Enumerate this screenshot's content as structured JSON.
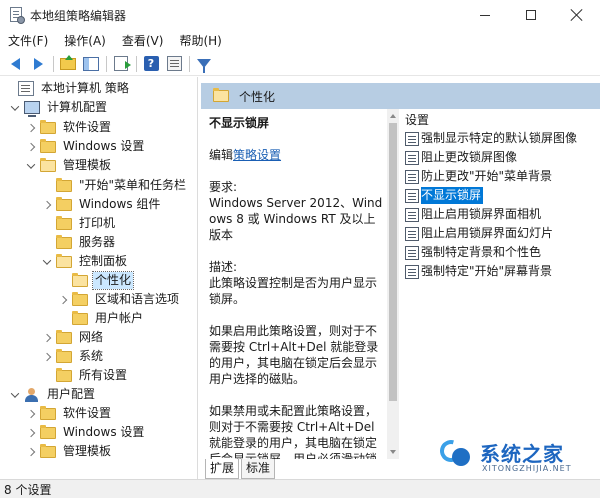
{
  "window": {
    "title": "本地组策略编辑器"
  },
  "menu": [
    "文件(F)",
    "操作(A)",
    "查看(V)",
    "帮助(H)"
  ],
  "tree": {
    "root": "本地计算机 策略",
    "computer_config": "计算机配置",
    "cc_software": "软件设置",
    "cc_windows": "Windows 设置",
    "cc_admin": "管理模板",
    "start_menu": "\"开始\"菜单和任务栏",
    "win_components": "Windows 组件",
    "printers": "打印机",
    "server": "服务器",
    "control_panel": "控制面板",
    "personalization": "个性化",
    "region_language": "区域和语言选项",
    "user_accounts": "用户帐户",
    "network": "网络",
    "system": "系统",
    "all_settings": "所有设置",
    "user_config": "用户配置",
    "uc_software": "软件设置",
    "uc_windows": "Windows 设置",
    "uc_admin": "管理模板"
  },
  "header": {
    "title": "个性化"
  },
  "description": {
    "title": "不显示锁屏",
    "edit_prefix": "编辑",
    "edit_link": "策略设置",
    "requirements_label": "要求:",
    "requirements": "Windows Server 2012、Windows 8 或 Windows RT 及以上版本",
    "desc_label": "描述:",
    "desc": "此策略设置控制是否为用户显示锁屏。",
    "para1": "如果启用此策略设置，则对于不需要按 Ctrl+Alt+Del 就能登录的用户，其电脑在锁定后会显示用户选择的磁贴。",
    "para2": "如果禁用或未配置此策略设置，则对于不需要按 Ctrl+Alt+Del 就能登录的用户，其电脑在锁定后会显示锁屏。用户必须滑动锁屏"
  },
  "settings": {
    "header": "设置",
    "items": [
      "强制显示特定的默认锁屏图像",
      "阻止更改锁屏图像",
      "防止更改\"开始\"菜单背景",
      "不显示锁屏",
      "阻止启用锁屏界面相机",
      "阻止启用锁屏界面幻灯片",
      "强制特定背景和个性色",
      "强制特定\"开始\"屏幕背景"
    ]
  },
  "tabs": [
    "扩展",
    "标准"
  ],
  "status": {
    "text": "8 个设置"
  },
  "watermark": {
    "name": "系统之家",
    "url": "XITONGZHIJIA.NET"
  },
  "colors": {
    "header_band": "#b7cde3",
    "selection": "#0078d7",
    "link": "#1a5fb4"
  }
}
